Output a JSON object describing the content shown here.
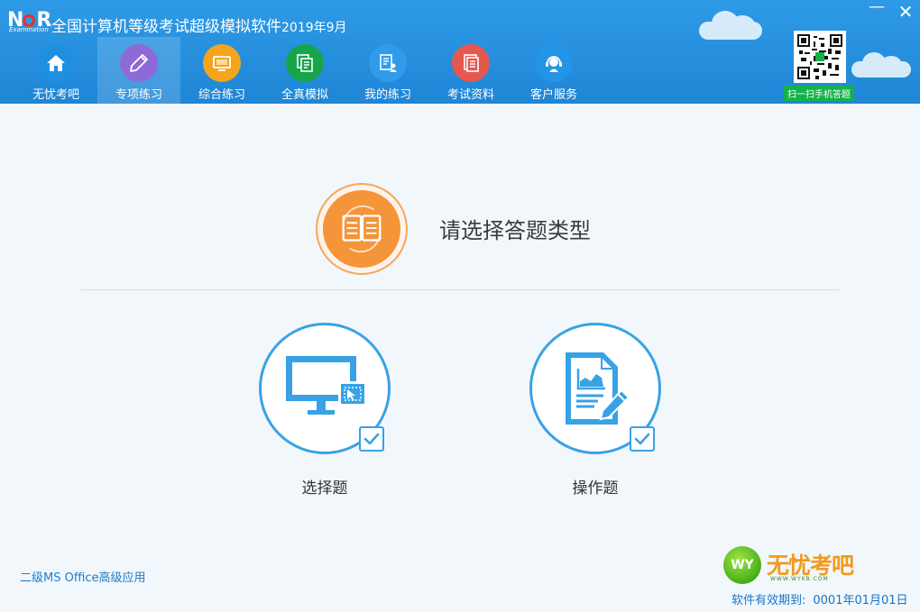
{
  "window": {
    "logo_text": "NCR",
    "logo_sub": "Examination",
    "title": "全国计算机等级考试超级模拟软件",
    "version": "2019年9月",
    "minimize_glyph": "—",
    "close_glyph": "✕"
  },
  "nav": {
    "active_index": 1,
    "items": [
      {
        "label": "无忧考吧",
        "icon": "home-icon",
        "color": "#1f8fe0"
      },
      {
        "label": "专项练习",
        "icon": "pencil-icon",
        "color": "#8e6ad9"
      },
      {
        "label": "综合练习",
        "icon": "monitor-icon",
        "color": "#f4a51c"
      },
      {
        "label": "全真模拟",
        "icon": "document-stack-icon",
        "color": "#16a54b"
      },
      {
        "label": "我的练习",
        "icon": "user-file-icon",
        "color": "#2f9bea"
      },
      {
        "label": "考试资料",
        "icon": "documents-icon",
        "color": "#e5584f"
      },
      {
        "label": "客户服务",
        "icon": "headset-icon",
        "color": "#2394e6"
      }
    ]
  },
  "qr": {
    "label": "扫一扫手机答题",
    "icon": "qr-code-icon"
  },
  "main": {
    "prompt": "请选择答题类型",
    "icon": "answer-sheet-icon",
    "choices": [
      {
        "label": "选择题",
        "icon": "monitor-choice-icon"
      },
      {
        "label": "操作题",
        "icon": "document-edit-icon"
      }
    ]
  },
  "footer": {
    "subject": "二级MS Office高级应用",
    "brand_badge": "WY",
    "brand_name": "无忧考吧",
    "brand_url": "WWW.WYKB.COM",
    "expiry_label": "软件有效期到:",
    "expiry_date": "0001年01月01日"
  },
  "colors": {
    "header": "#2e9ae6",
    "accent": "#38a2e6",
    "orange": "#f59539",
    "link": "#1c7dc9"
  }
}
